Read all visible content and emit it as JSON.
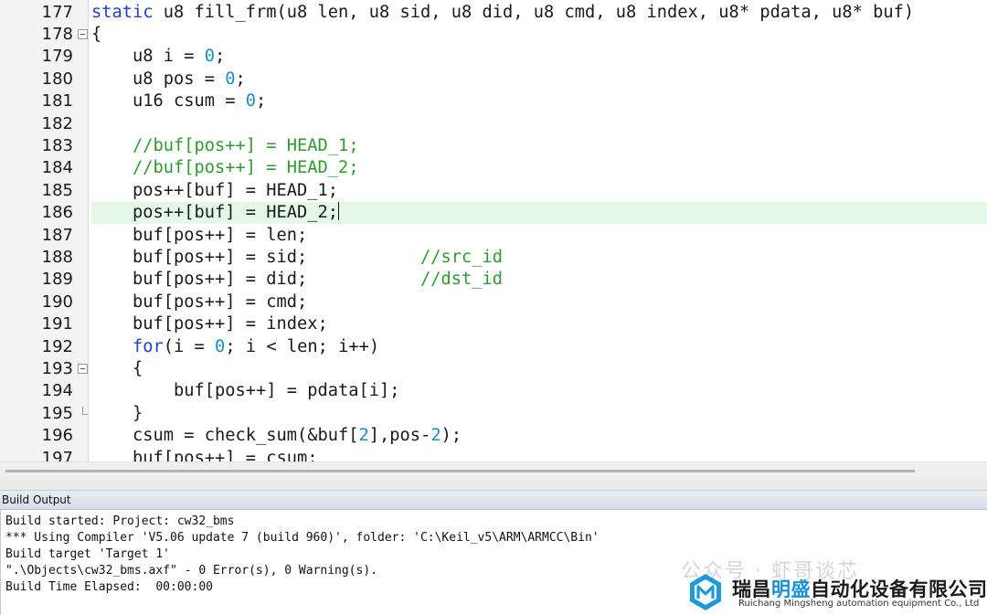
{
  "editor": {
    "lines": [
      {
        "num": "177",
        "fold": "",
        "tokens": [
          {
            "t": "static",
            "c": "kw"
          },
          {
            "t": " u8 fill_frm(u8 len, u8 sid, u8 did, u8 cmd, u8 index, u8* pdata, u8* buf)"
          }
        ]
      },
      {
        "num": "178",
        "fold": "open",
        "tokens": [
          {
            "t": "{"
          }
        ]
      },
      {
        "num": "179",
        "fold": "",
        "tokens": [
          {
            "t": "    u8 i = "
          },
          {
            "t": "0",
            "c": "num"
          },
          {
            "t": ";"
          }
        ]
      },
      {
        "num": "180",
        "fold": "",
        "tokens": [
          {
            "t": "    u8 pos = "
          },
          {
            "t": "0",
            "c": "num"
          },
          {
            "t": ";"
          }
        ]
      },
      {
        "num": "181",
        "fold": "",
        "tokens": [
          {
            "t": "    u16 csum = "
          },
          {
            "t": "0",
            "c": "num"
          },
          {
            "t": ";"
          }
        ]
      },
      {
        "num": "182",
        "fold": "",
        "tokens": []
      },
      {
        "num": "183",
        "fold": "",
        "tokens": [
          {
            "t": "    "
          },
          {
            "t": "//buf[pos++] = HEAD_1;",
            "c": "cm"
          }
        ]
      },
      {
        "num": "184",
        "fold": "",
        "tokens": [
          {
            "t": "    "
          },
          {
            "t": "//buf[pos++] = HEAD_2;",
            "c": "cm"
          }
        ]
      },
      {
        "num": "185",
        "fold": "",
        "tokens": [
          {
            "t": "    pos++[buf] = HEAD_1;"
          }
        ]
      },
      {
        "num": "186",
        "fold": "",
        "current": true,
        "tokens": [
          {
            "t": "    pos++[buf] = HEAD_2;"
          }
        ]
      },
      {
        "num": "187",
        "fold": "",
        "tokens": [
          {
            "t": "    buf[pos++] = len;"
          }
        ]
      },
      {
        "num": "188",
        "fold": "",
        "tokens": [
          {
            "t": "    buf[pos++] = sid;           "
          },
          {
            "t": "//src_id",
            "c": "cm"
          }
        ]
      },
      {
        "num": "189",
        "fold": "",
        "tokens": [
          {
            "t": "    buf[pos++] = did;           "
          },
          {
            "t": "//dst_id",
            "c": "cm"
          }
        ]
      },
      {
        "num": "190",
        "fold": "",
        "tokens": [
          {
            "t": "    buf[pos++] = cmd;"
          }
        ]
      },
      {
        "num": "191",
        "fold": "",
        "tokens": [
          {
            "t": "    buf[pos++] = index;"
          }
        ]
      },
      {
        "num": "192",
        "fold": "",
        "tokens": [
          {
            "t": "    "
          },
          {
            "t": "for",
            "c": "kw"
          },
          {
            "t": "(i = "
          },
          {
            "t": "0",
            "c": "num"
          },
          {
            "t": "; i < len; i++)"
          }
        ]
      },
      {
        "num": "193",
        "fold": "open",
        "tokens": [
          {
            "t": "    {"
          }
        ]
      },
      {
        "num": "194",
        "fold": "",
        "tokens": [
          {
            "t": "        buf[pos++] = pdata[i];"
          }
        ]
      },
      {
        "num": "195",
        "fold": "end",
        "tokens": [
          {
            "t": "    }"
          }
        ]
      },
      {
        "num": "196",
        "fold": "",
        "tokens": [
          {
            "t": "    csum = check_sum(&buf["
          },
          {
            "t": "2",
            "c": "num"
          },
          {
            "t": "],pos-"
          },
          {
            "t": "2",
            "c": "num"
          },
          {
            "t": ");"
          }
        ]
      },
      {
        "num": "197",
        "fold": "",
        "tokens": [
          {
            "t": "    buf[pos++] = csum;"
          }
        ]
      }
    ]
  },
  "build_output": {
    "title": "Build Output",
    "lines": [
      "Build started: Project: cw32_bms",
      "*** Using Compiler 'V5.06 update 7 (build 960)', folder: 'C:\\Keil_v5\\ARM\\ARMCC\\Bin'",
      "Build target 'Target 1'",
      "\".\\Objects\\cw32_bms.axf\" - 0 Error(s), 0 Warning(s).",
      "Build Time Elapsed:  00:00:00"
    ]
  },
  "watermark": {
    "faint_text": "公众号 · 虾哥谈芯",
    "company_cn_a": "瑞昌",
    "company_cn_b": "明盛",
    "company_cn_c": "自动化设备有限公司",
    "company_en": "Ruichang Mingsheng automation equipment Co., Ltd"
  }
}
